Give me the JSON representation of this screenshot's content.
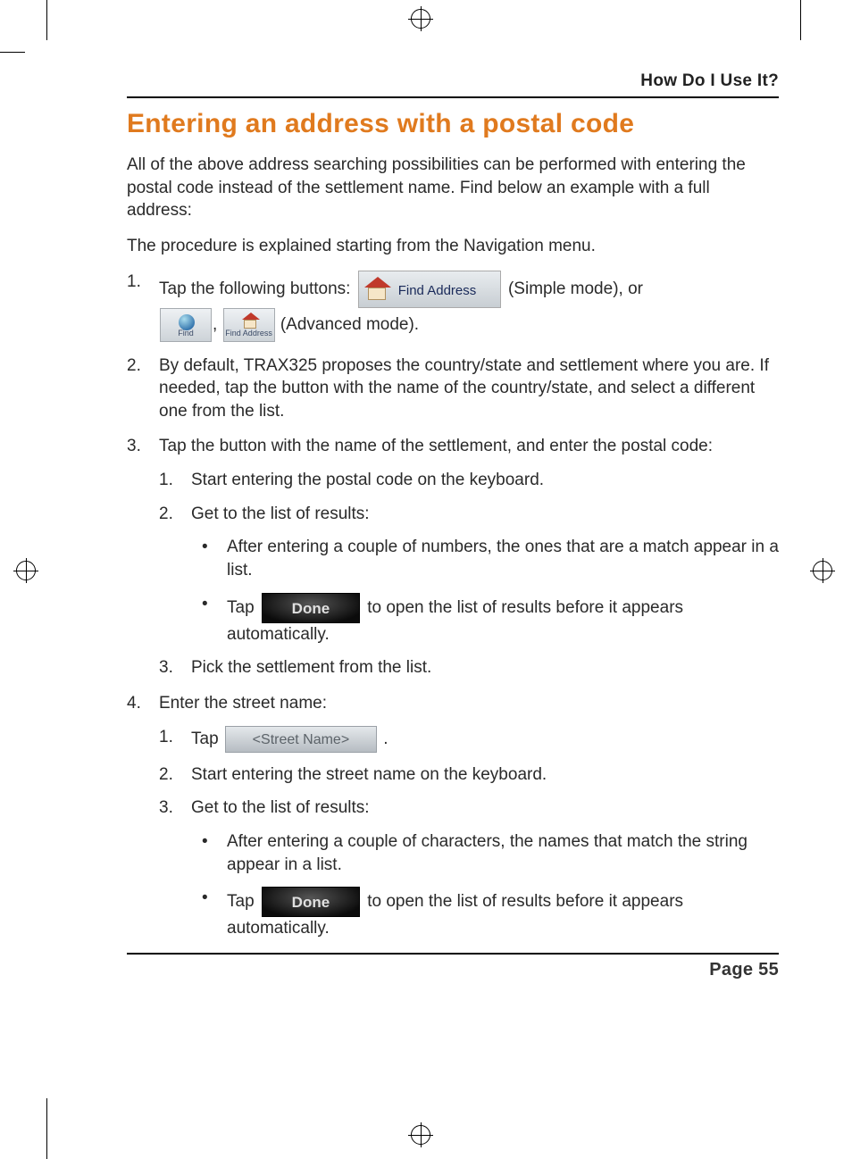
{
  "header": {
    "section": "How Do I Use It?"
  },
  "title": "Entering an address with a postal code",
  "intro1": "All of the above address searching possibilities can be performed with entering the postal code instead of the settlement name. Find below an example with a full address:",
  "intro2": "The procedure is explained starting from the Navigation menu.",
  "steps": {
    "s1": {
      "pre": "Tap the following buttons: ",
      "btn_find_address": "Find Address",
      "mid": " (Simple mode), or ",
      "btn_find": "Find",
      "btn_find_addr_small": "Find Address",
      "post": " (Advanced mode)."
    },
    "s2": "By default, TRAX325 proposes the country/state and settlement where you are. If needed, tap the button with the name of the country/state, and select a different one from the list.",
    "s3": {
      "lead": "Tap the button with the name of the settlement, and enter the postal code:",
      "a": "Start entering the postal code on the keyboard.",
      "b": "Get to the list of results:",
      "b1": "After entering a couple of numbers, the ones that are a match appear in a list.",
      "b2_pre": "Tap ",
      "b2_btn": "Done",
      "b2_post": " to open the list of results before it appears automatically.",
      "c": "Pick the settlement from the list."
    },
    "s4": {
      "lead": "Enter the street name:",
      "a_pre": "Tap ",
      "a_btn": "<Street Name>",
      "a_post": ".",
      "b": "Start entering the street name on the keyboard.",
      "c": "Get to the list of results:",
      "c1": "After entering a couple of characters, the names that match the string appear in a list.",
      "c2_pre": "Tap ",
      "c2_btn": "Done",
      "c2_post": " to open the list of results before it appears automatically."
    }
  },
  "footer": {
    "page": "Page 55"
  }
}
